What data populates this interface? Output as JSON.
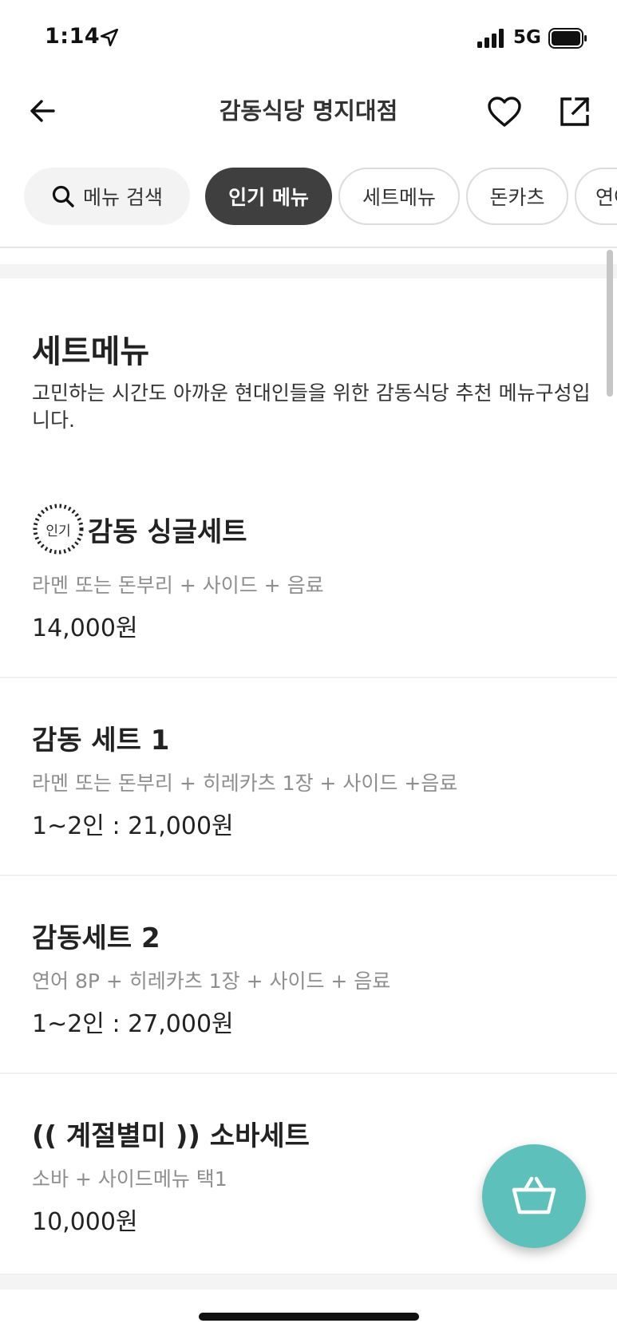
{
  "status_bar": {
    "time": "1:14",
    "network": "5G"
  },
  "header": {
    "title": "감동식당 명지대점"
  },
  "tabs": {
    "search_label": "메뉴 검색",
    "items": [
      {
        "label": "인기 메뉴",
        "active": true
      },
      {
        "label": "세트메뉴",
        "active": false
      },
      {
        "label": "돈카츠",
        "active": false
      },
      {
        "label": "연어",
        "active": false
      }
    ]
  },
  "section": {
    "title": "세트메뉴",
    "description": "고민하는 시간도 아까운 현대인들을 위한 감동식당 추천 메뉴구성입니다."
  },
  "menu_items": [
    {
      "badge": "인기",
      "name": "감동 싱글세트",
      "description": "라멘 또는 돈부리 + 사이드 + 음료",
      "price": "14,000원"
    },
    {
      "name": "감동 세트 1",
      "description": "라멘 또는 돈부리 + 히레카츠 1장 + 사이드 +음료",
      "price": "1~2인 : 21,000원"
    },
    {
      "name": "감동세트 2",
      "description": "연어 8P + 히레카츠 1장 + 사이드 + 음료",
      "price": "1~2인 : 27,000원"
    },
    {
      "name": "(( 계절별미 )) 소바세트",
      "description": "소바 + 사이드메뉴 택1",
      "price": "10,000원"
    }
  ],
  "colors": {
    "accent_teal": "#5ec0bb",
    "active_tab": "#3f3f3f",
    "muted_text": "#8e8e8e"
  },
  "icons": {
    "back": "arrow-left-icon",
    "favorite": "heart-icon",
    "share": "share-icon",
    "search": "search-icon",
    "cart": "basket-icon"
  }
}
